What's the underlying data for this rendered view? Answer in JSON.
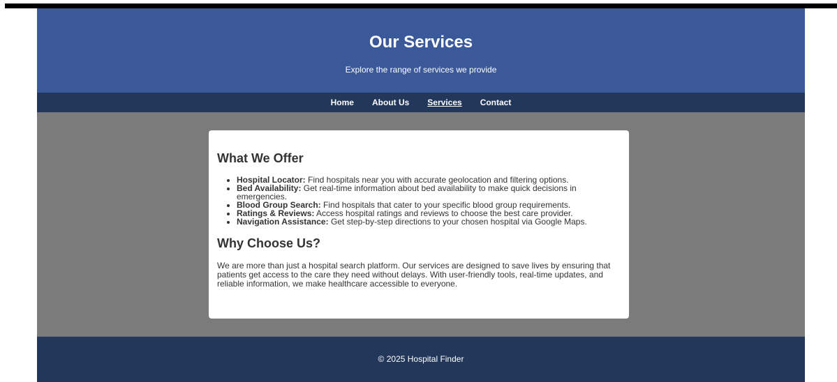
{
  "header": {
    "title": "Our Services",
    "subtitle": "Explore the range of services we provide"
  },
  "nav": {
    "items": [
      {
        "label": "Home"
      },
      {
        "label": "About Us"
      },
      {
        "label": "Services",
        "active": true
      },
      {
        "label": "Contact"
      }
    ]
  },
  "offer": {
    "heading": "What We Offer",
    "items": [
      {
        "title": "Hospital Locator:",
        "text": " Find hospitals near you with accurate geolocation and filtering options."
      },
      {
        "title": "Bed Availability:",
        "text": " Get real-time information about bed availability to make quick decisions in emergencies."
      },
      {
        "title": "Blood Group Search:",
        "text": " Find hospitals that cater to your specific blood group requirements."
      },
      {
        "title": "Ratings & Reviews:",
        "text": " Access hospital ratings and reviews to choose the best care provider."
      },
      {
        "title": "Navigation Assistance:",
        "text": " Get step-by-step directions to your chosen hospital via Google Maps."
      }
    ]
  },
  "why": {
    "heading": "Why Choose Us?",
    "text": "We are more than just a hospital search platform. Our services are designed to save lives by ensuring that patients get access to the care they need without delays. With user-friendly tools, real-time updates, and reliable information, we make healthcare accessible to everyone."
  },
  "footer": {
    "text": "© 2025 Hospital Finder"
  },
  "colors": {
    "header_bg": "#3b5998",
    "nav_bg": "#23375a",
    "main_bg": "#7b7b7b",
    "card_bg": "#ffffff"
  }
}
